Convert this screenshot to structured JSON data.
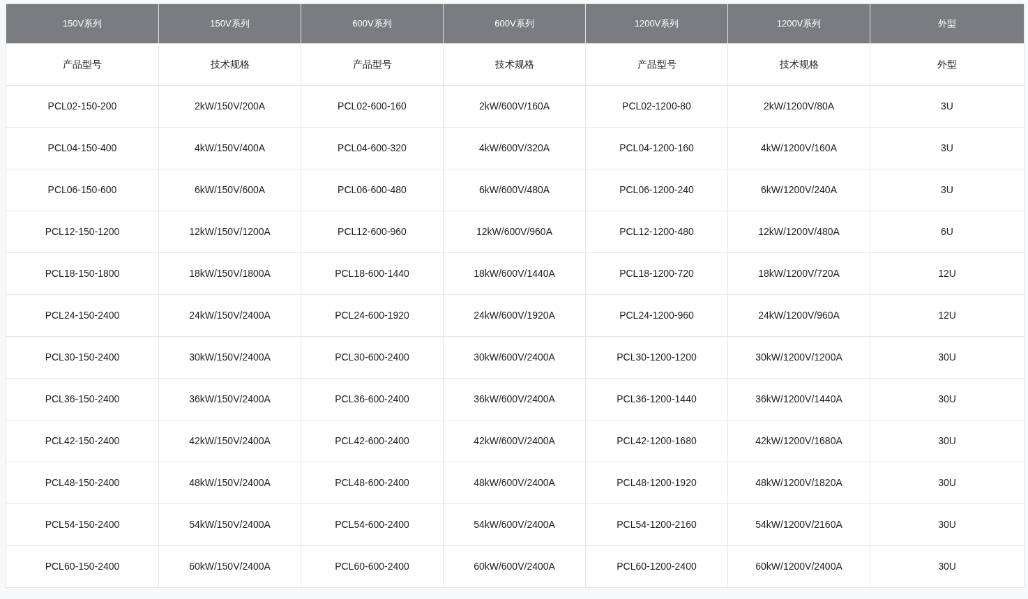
{
  "table": {
    "columns": [
      "150V系列",
      "150V系列",
      "600V系列",
      "600V系列",
      "1200V系列",
      "1200V系列",
      "外型"
    ],
    "subheader": [
      "产品型号",
      "技术规格",
      "产品型号",
      "技术规格",
      "产品型号",
      "技术规格",
      "外型"
    ],
    "rows": [
      [
        "PCL02-150-200",
        "2kW/150V/200A",
        "PCL02-600-160",
        "2kW/600V/160A",
        "PCL02-1200-80",
        "2kW/1200V/80A",
        "3U"
      ],
      [
        "PCL04-150-400",
        "4kW/150V/400A",
        "PCL04-600-320",
        "4kW/600V/320A",
        "PCL04-1200-160",
        "4kW/1200V/160A",
        "3U"
      ],
      [
        "PCL06-150-600",
        "6kW/150V/600A",
        "PCL06-600-480",
        "6kW/600V/480A",
        "PCL06-1200-240",
        "6kW/1200V/240A",
        "3U"
      ],
      [
        "PCL12-150-1200",
        "12kW/150V/1200A",
        "PCL12-600-960",
        "12kW/600V/960A",
        "PCL12-1200-480",
        "12kW/1200V/480A",
        "6U"
      ],
      [
        "PCL18-150-1800",
        "18kW/150V/1800A",
        "PCL18-600-1440",
        "18kW/600V/1440A",
        "PCL18-1200-720",
        "18kW/1200V/720A",
        "12U"
      ],
      [
        "PCL24-150-2400",
        "24kW/150V/2400A",
        "PCL24-600-1920",
        "24kW/600V/1920A",
        "PCL24-1200-960",
        "24kW/1200V/960A",
        "12U"
      ],
      [
        "PCL30-150-2400",
        "30kW/150V/2400A",
        "PCL30-600-2400",
        "30kW/600V/2400A",
        "PCL30-1200-1200",
        "30kW/1200V/1200A",
        "30U"
      ],
      [
        "PCL36-150-2400",
        "36kW/150V/2400A",
        "PCL36-600-2400",
        "36kW/600V/2400A",
        "PCL36-1200-1440",
        "36kW/1200V/1440A",
        "30U"
      ],
      [
        "PCL42-150-2400",
        "42kW/150V/2400A",
        "PCL42-600-2400",
        "42kW/600V/2400A",
        "PCL42-1200-1680",
        "42kW/1200V/1680A",
        "30U"
      ],
      [
        "PCL48-150-2400",
        "48kW/150V/2400A",
        "PCL48-600-2400",
        "48kW/600V/2400A",
        "PCL48-1200-1920",
        "48kW/1200V/1820A",
        "30U"
      ],
      [
        "PCL54-150-2400",
        "54kW/150V/2400A",
        "PCL54-600-2400",
        "54kW/600V/2400A",
        "PCL54-1200-2160",
        "54kW/1200V/2160A",
        "30U"
      ],
      [
        "PCL60-150-2400",
        "60kW/150V/2400A",
        "PCL60-600-2400",
        "60kW/600V/2400A",
        "PCL60-1200-2400",
        "60kW/1200V/2400A",
        "30U"
      ]
    ]
  }
}
